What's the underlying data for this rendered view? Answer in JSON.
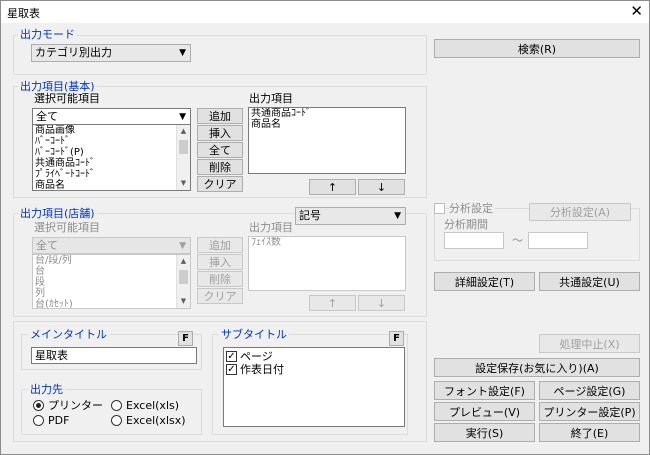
{
  "window": {
    "title": "星取表",
    "close_glyph": "✕"
  },
  "output_mode": {
    "label": "出力モード",
    "selected": "カテゴリ別出力"
  },
  "basic": {
    "label": "出力項目(基本)",
    "selectable_label": "選択可能項目",
    "filter_selected": "全て",
    "available_items": [
      "商品画像",
      "ﾊﾞｰｺｰﾄﾞ",
      "ﾊﾞｰｺｰﾄﾞ(P)",
      "共通商品ｺｰﾄﾞ",
      "ﾌﾟﾗｲﾍﾞｰﾄｺｰﾄﾞ",
      "商品名"
    ],
    "output_label": "出力項目",
    "output_items": [
      "共通商品ｺｰﾄﾞ",
      "商品名"
    ],
    "add_label": "追加",
    "insert_label": "挿入",
    "all_label": "全て",
    "delete_label": "削除",
    "clear_label": "クリア",
    "up_label": "↑",
    "down_label": "↓"
  },
  "store": {
    "label": "出力項目(店舗)",
    "selectable_label": "選択可能項目",
    "filter_selected": "全て",
    "available_items": [
      "台/段/列",
      "台",
      "段",
      "列",
      "台(ｶｾｯﾄ)"
    ],
    "output_label": "出力項目",
    "output_items": [
      "ﾌｪｲｽ数"
    ],
    "symbol_selected": "記号",
    "add_label": "追加",
    "insert_label": "挿入",
    "delete_label": "削除",
    "clear_label": "クリア",
    "up_label": "↑",
    "down_label": "↓"
  },
  "main_title": {
    "label": "メインタイトル",
    "f_label": "F",
    "value": "星取表"
  },
  "subtitle": {
    "label": "サブタイトル",
    "f_label": "F",
    "items": [
      {
        "text": "ページ",
        "checked": true
      },
      {
        "text": "作表日付",
        "checked": true
      }
    ],
    "check_glyph": "✓"
  },
  "destination": {
    "label": "出力先",
    "options": [
      "プリンター",
      "PDF",
      "Excel(xls)",
      "Excel(xlsx)"
    ],
    "selected": "プリンター"
  },
  "search_label": "検索(R)",
  "analysis": {
    "label": "分析設定",
    "button_label": "分析設定(A)",
    "period_label": "分析期間",
    "tilde": "～"
  },
  "buttons": {
    "detail": "詳細設定(T)",
    "common": "共通設定(U)",
    "stop": "処理中止(X)",
    "save": "設定保存(お気に入り)(A)",
    "font": "フォント設定(F)",
    "page": "ページ設定(G)",
    "preview": "プレビュー(V)",
    "printer": "プリンター設定(P)",
    "run": "実行(S)",
    "exit": "終了(E)"
  },
  "icons": {
    "dropdown": "▼",
    "scroll_up": "▲",
    "scroll_down": "▼"
  },
  "colors": {
    "group_label": "#0033cc",
    "window_bg": "#f0f0f0"
  }
}
